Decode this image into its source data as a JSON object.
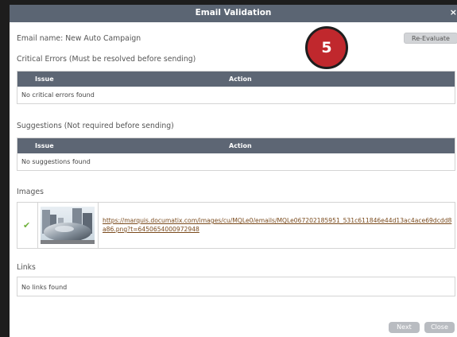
{
  "dialog": {
    "title": "Email Validation",
    "close_label": "×"
  },
  "email": {
    "name_text": "Email name: New Auto Campaign",
    "reevaluate_label": "Re-Evaluate"
  },
  "step_badge": "5",
  "critical": {
    "heading": "Critical Errors (Must be resolved before sending)",
    "columns": [
      "Issue",
      "Action"
    ],
    "empty_text": "No critical errors found"
  },
  "suggestions": {
    "heading": "Suggestions (Not required before sending)",
    "columns": [
      "Issue",
      "Action"
    ],
    "empty_text": "No suggestions found"
  },
  "images": {
    "heading": "Images",
    "items": [
      {
        "status_icon": "checkmark-icon",
        "url": "https://marquis.documatix.com/images/cu/MQLe0/emails/MQLe067202185951_531c611846e44d13ac4ace69dcdd8a86.png?t=6450654000972948"
      }
    ]
  },
  "links": {
    "heading": "Links",
    "empty_text": "No links found"
  },
  "footer": {
    "next_label": "Next",
    "close_label": "Close"
  },
  "colors": {
    "header_bar": "#5b6573",
    "badge": "#c0282d",
    "check": "#6fb13c",
    "link": "#7a4a1c"
  }
}
